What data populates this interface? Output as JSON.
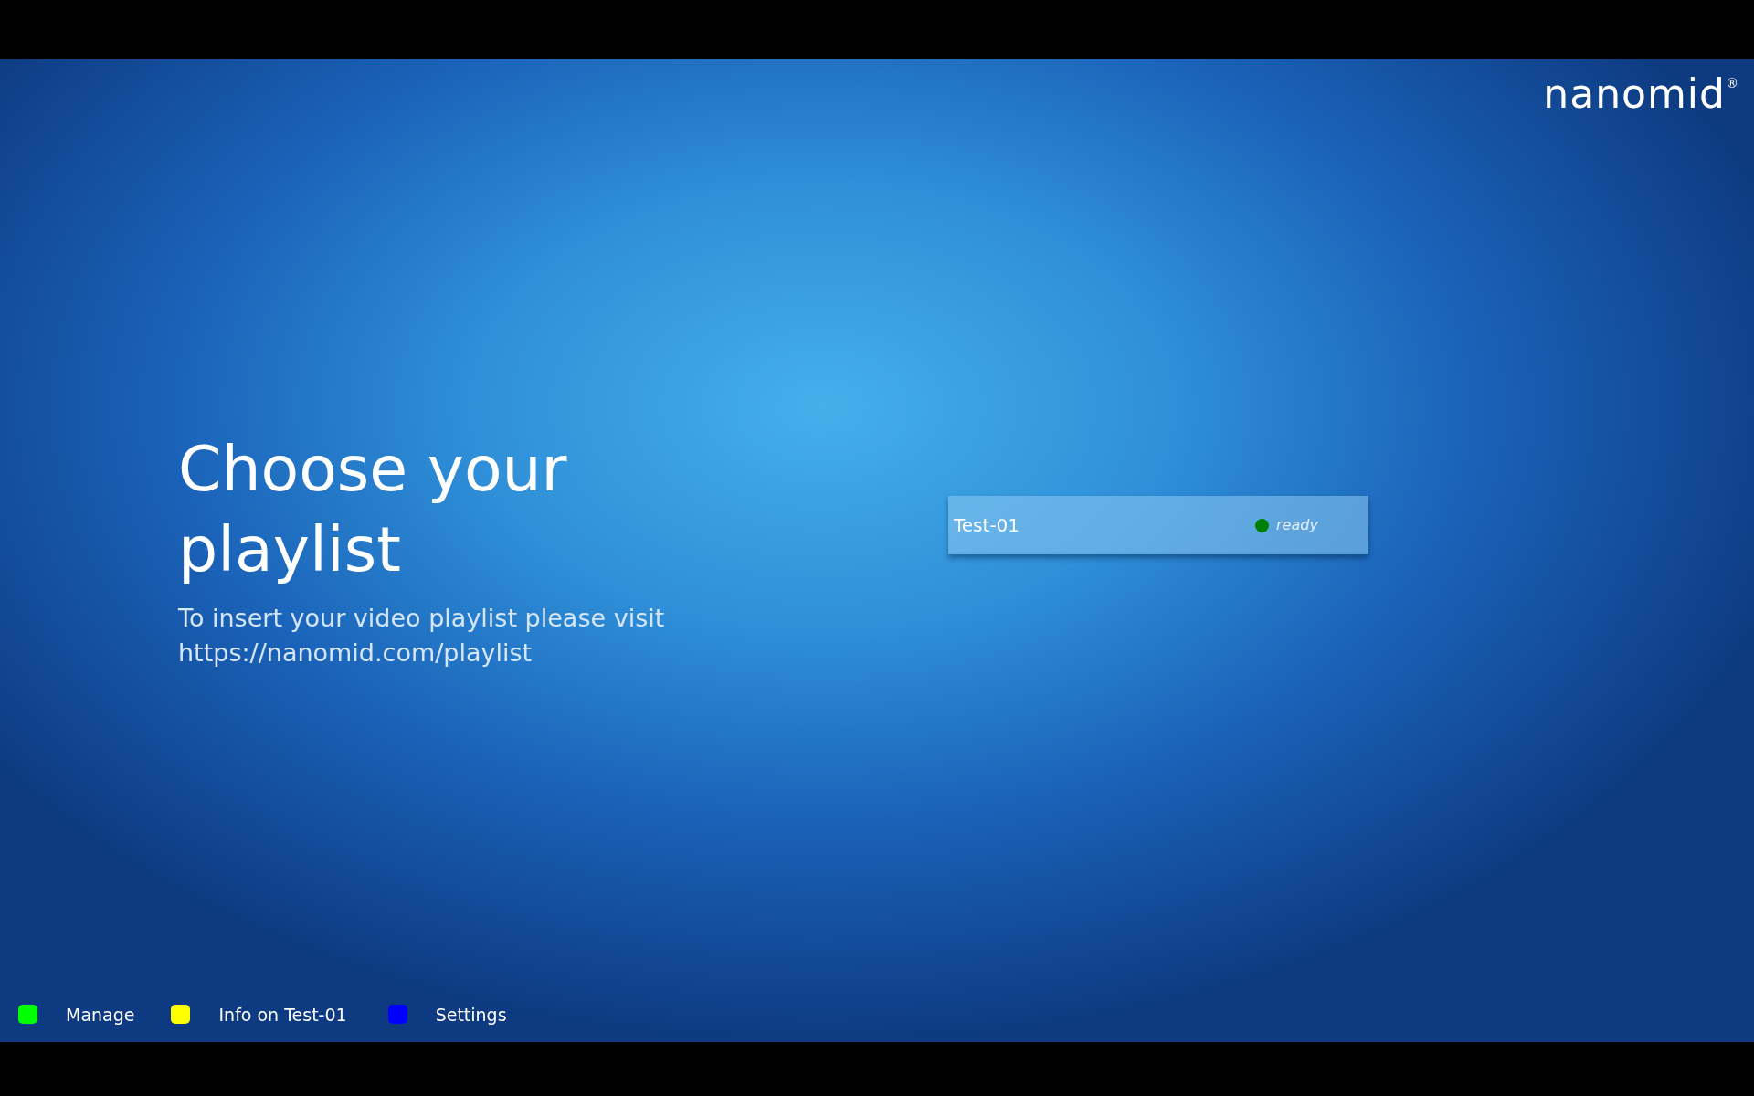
{
  "logo": {
    "text": "nanomid$^{®}$"
  },
  "heading": "Choose your playlist",
  "subtitle": "To insert your video playlist please visit https://nanomid.com/playlist",
  "playlists": [
    {
      "name": "Test-01",
      "status": "ready",
      "color": "#008000"
    }
  ],
  "legend": [
    {
      "label": "Manage",
      "color": "#00ff00"
    },
    {
      "label": "Info on Test-01",
      "color": "#ffff00"
    },
    {
      "label": "Settings",
      "color": "#0000ff"
    }
  ]
}
